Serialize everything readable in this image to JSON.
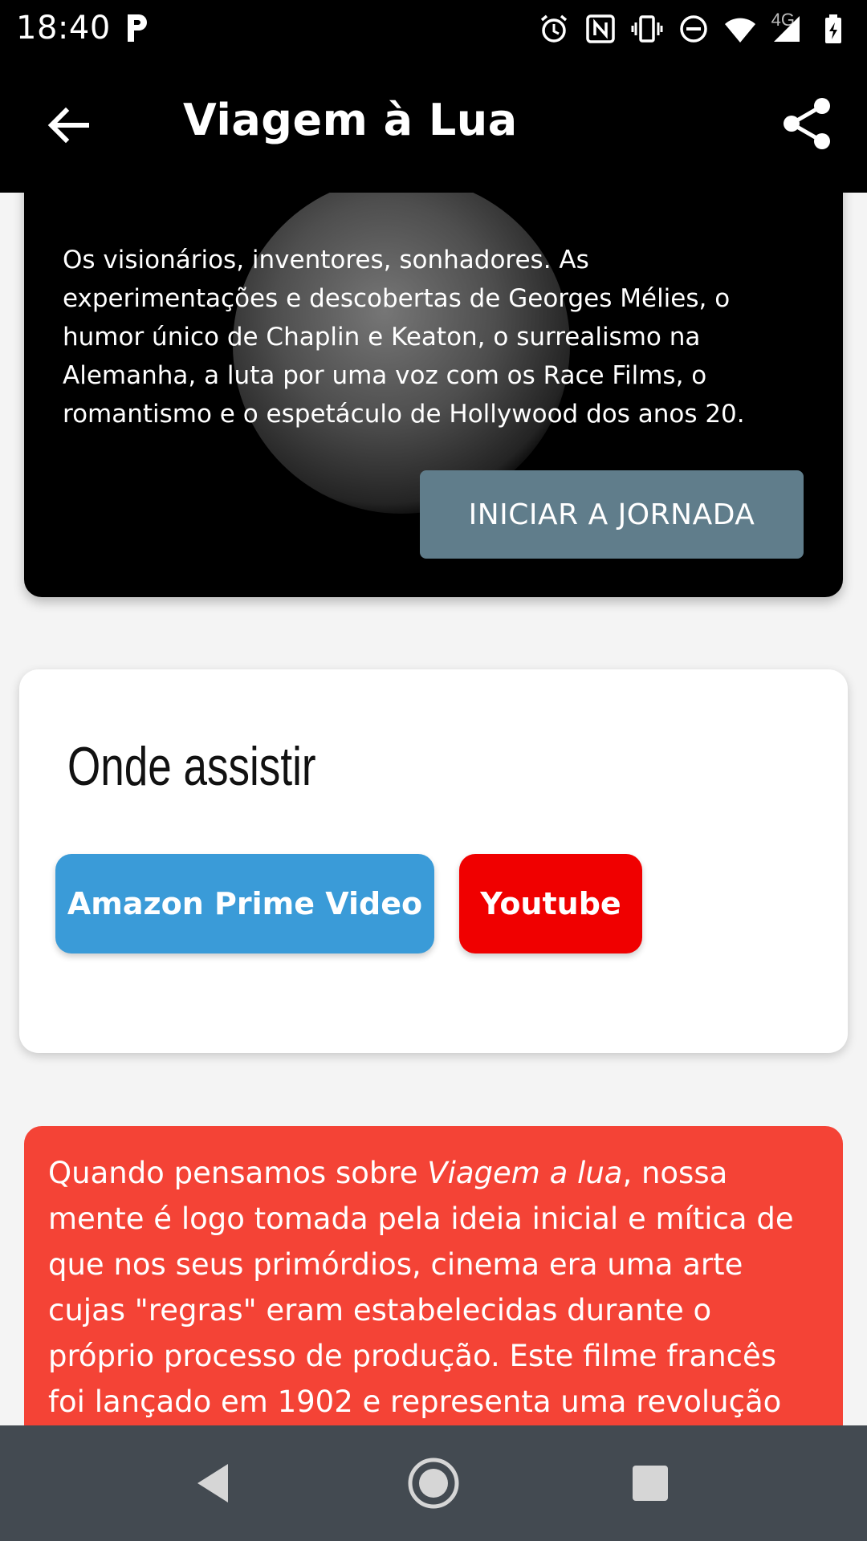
{
  "status_bar": {
    "time": "18:40",
    "network": "4G",
    "icons": [
      "p-icon",
      "alarm-icon",
      "nfc-icon",
      "vibrate-icon",
      "do-not-disturb-icon",
      "wifi-icon",
      "signal-icon",
      "battery-charging-icon"
    ]
  },
  "app_bar": {
    "title": "Viagem à Lua",
    "back_icon": "arrow-back-icon",
    "share_icon": "share-icon"
  },
  "hero": {
    "description": "Os visionários, inventores, sonhadores. As experimentações e descobertas de Georges Mélies, o humor único de Chaplin e Keaton, o surrealismo na Alemanha, a luta por uma voz com os Race Films, o romantismo e o espetáculo de Hollywood dos anos 20.",
    "button_label": "INICIAR A JORNADA",
    "button_color": "#607d8b"
  },
  "where_to_watch": {
    "title": "Onde assistir",
    "providers": [
      {
        "label": "Amazon Prime Video",
        "color": "#3a9bd8"
      },
      {
        "label": "Youtube",
        "color": "#f00000"
      }
    ]
  },
  "description_card": {
    "intro": "Quando pensamos sobre ",
    "italic_title": "Viagem a lua",
    "body": ", nossa mente é logo tomada pela ideia inicial e mítica de que nos seus primórdios, cinema era uma arte cujas \"regras\" eram estabelecidas durante o próprio processo de produção. Este filme francês foi lançado em 1902 e representa uma revolução",
    "color": "#f44336"
  },
  "nav_bar": {
    "buttons": [
      "nav-back-icon",
      "nav-home-icon",
      "nav-recents-icon"
    ]
  }
}
